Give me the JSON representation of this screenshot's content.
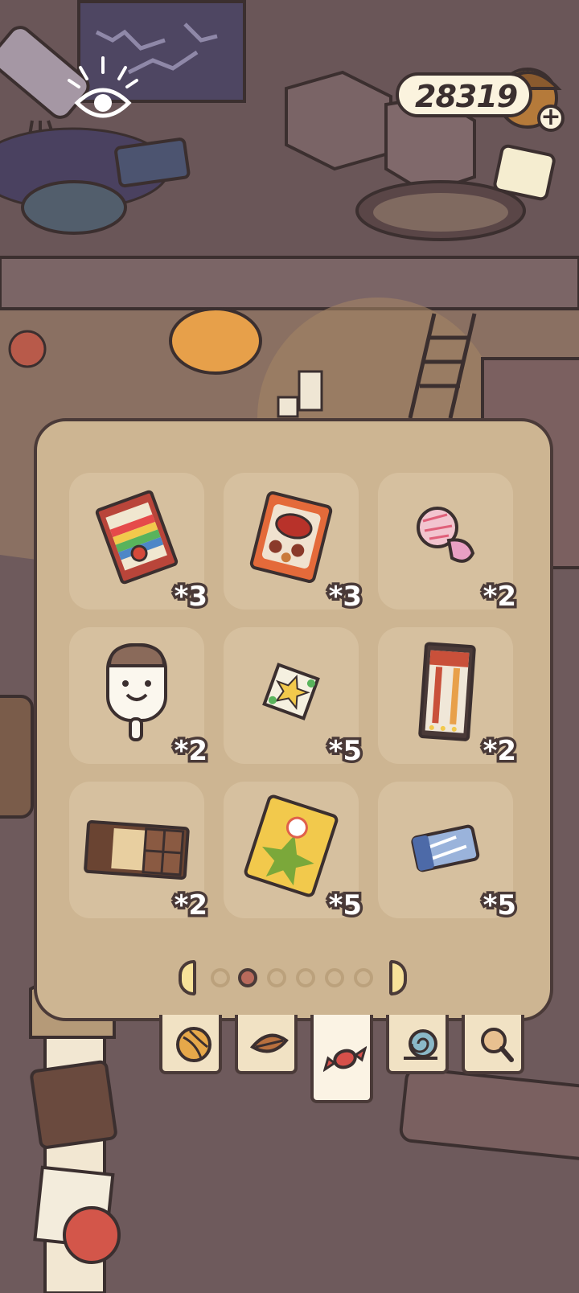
{
  "currency": {
    "value": "28319",
    "add_label": "+"
  },
  "inventory": {
    "items": [
      {
        "name": "rainbow-candy-bag",
        "count": "*3"
      },
      {
        "name": "cookie-snack-bag",
        "count": "*3"
      },
      {
        "name": "pink-pacifier-candy",
        "count": "*2"
      },
      {
        "name": "smiley-ice-cream-bar",
        "count": "*2"
      },
      {
        "name": "star-candy-wrapper",
        "count": "*5"
      },
      {
        "name": "candy-stick-pack",
        "count": "*2"
      },
      {
        "name": "chocolate-bar",
        "count": "*2"
      },
      {
        "name": "yellow-chip-bag",
        "count": "*5"
      },
      {
        "name": "blue-wrapped-candy",
        "count": "*5"
      }
    ],
    "pages": {
      "total": 6,
      "current": 2
    }
  },
  "tabs": [
    {
      "name": "yarn-ball",
      "active": false
    },
    {
      "name": "leaf",
      "active": false
    },
    {
      "name": "candy",
      "active": true
    },
    {
      "name": "snail-shell",
      "active": false
    },
    {
      "name": "magnifier",
      "active": false
    }
  ],
  "colors": {
    "panel": "#cdb592",
    "slot": "#d6c09f",
    "outline": "#4a3a38",
    "active_dot": "#b86a5c"
  }
}
